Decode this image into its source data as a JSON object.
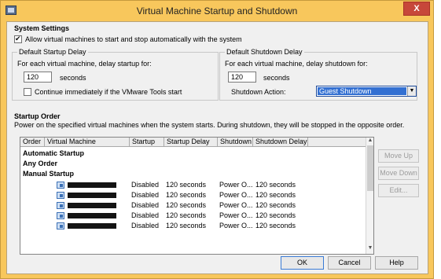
{
  "window": {
    "title": "Virtual Machine Startup and Shutdown",
    "close_label": "X"
  },
  "system_settings": {
    "heading": "System Settings",
    "allow_auto_label": "Allow virtual machines to start and stop automatically with the system",
    "allow_auto_checked": true
  },
  "startup_delay": {
    "group_label": "Default Startup Delay",
    "description": "For each virtual machine, delay startup for:",
    "value": "120",
    "unit": "seconds",
    "continue_label": "Continue immediately if the VMware Tools start",
    "continue_checked": false
  },
  "shutdown_delay": {
    "group_label": "Default Shutdown Delay",
    "description": "For each virtual machine, delay shutdown for:",
    "value": "120",
    "unit": "seconds",
    "action_label": "Shutdown Action:",
    "action_value": "Guest Shutdown"
  },
  "startup_order": {
    "heading": "Startup Order",
    "description": "Power on the specified virtual machines when the system starts. During shutdown, they will be stopped in the opposite order.",
    "columns": [
      "Order",
      "Virtual Machine",
      "Startup",
      "Startup Delay",
      "Shutdown",
      "Shutdown Delay"
    ],
    "groups": [
      "Automatic Startup",
      "Any Order",
      "Manual Startup"
    ],
    "rows": [
      {
        "startup": "Disabled",
        "startup_delay": "120 seconds",
        "shutdown": "Power O...",
        "shutdown_delay": "120 seconds"
      },
      {
        "startup": "Disabled",
        "startup_delay": "120 seconds",
        "shutdown": "Power O...",
        "shutdown_delay": "120 seconds"
      },
      {
        "startup": "Disabled",
        "startup_delay": "120 seconds",
        "shutdown": "Power O...",
        "shutdown_delay": "120 seconds"
      },
      {
        "startup": "Disabled",
        "startup_delay": "120 seconds",
        "shutdown": "Power O...",
        "shutdown_delay": "120 seconds"
      },
      {
        "startup": "Disabled",
        "startup_delay": "120 seconds",
        "shutdown": "Power O...",
        "shutdown_delay": "120 seconds"
      }
    ]
  },
  "side_buttons": {
    "move_up": "Move Up",
    "move_down": "Move Down",
    "edit": "Edit..."
  },
  "footer_buttons": {
    "ok": "OK",
    "cancel": "Cancel",
    "help": "Help"
  }
}
